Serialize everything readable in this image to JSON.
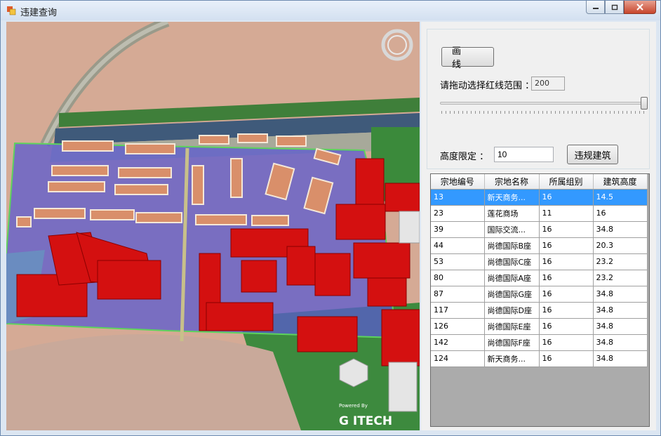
{
  "window": {
    "title": "违建查询"
  },
  "map": {
    "brand_powered_by": "Powered By",
    "brand_logo": "G ITECH",
    "compass_icon": "compass-ring-icon"
  },
  "panel": {
    "draw_button_label": "画 线",
    "range_label": "请拖动选择红线范围 ：",
    "range_value": "200",
    "slider_level": 1.0,
    "height_label": "高度限定 ：",
    "height_value": "10",
    "violation_button_label": "违规建筑"
  },
  "table": {
    "columns": [
      "宗地编号",
      "宗地名称",
      "所属组别",
      "建筑高度"
    ],
    "rows": [
      [
        "13",
        "新天商务...",
        "16",
        "14.5"
      ],
      [
        "23",
        "莲花商场",
        "11",
        "16"
      ],
      [
        "39",
        "国际交流...",
        "16",
        "34.8"
      ],
      [
        "44",
        "尚德国际B座",
        "16",
        "20.3"
      ],
      [
        "53",
        "尚德国际C座",
        "16",
        "23.2"
      ],
      [
        "80",
        "尚德国际A座",
        "16",
        "23.2"
      ],
      [
        "87",
        "尚德国际G座",
        "16",
        "34.8"
      ],
      [
        "117",
        "尚德国际D座",
        "16",
        "34.8"
      ],
      [
        "126",
        "尚德国际E座",
        "16",
        "34.8"
      ],
      [
        "142",
        "尚德国际F座",
        "16",
        "34.8"
      ],
      [
        "124",
        "新天商务...",
        "16",
        "34.8"
      ]
    ],
    "selected_row": 0
  },
  "colors": {
    "selection": "#3399ff",
    "violation_building": "#d41010",
    "zone_overlay": "#5a5ad0",
    "redline": "#5dd35d"
  }
}
